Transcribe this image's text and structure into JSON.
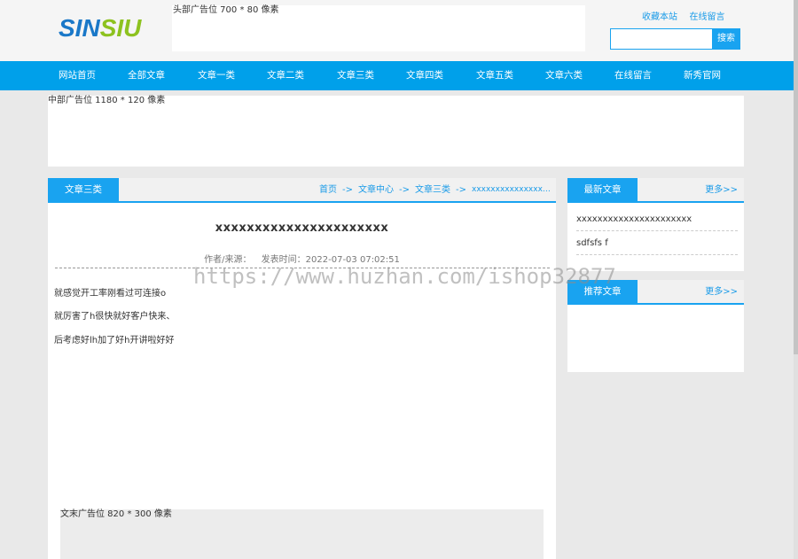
{
  "header": {
    "logo": {
      "part1": "SIN",
      "part2": "SIU"
    },
    "head_ad": "头部广告位 700 * 80 像素",
    "links": {
      "favorite": "收藏本站",
      "message": "在线留言"
    },
    "search": {
      "value": "",
      "placeholder": "",
      "button": "搜索"
    }
  },
  "nav": {
    "items": [
      "网站首页",
      "全部文章",
      "文章一类",
      "文章二类",
      "文章三类",
      "文章四类",
      "文章五类",
      "文章六类",
      "在线留言",
      "新秀官网"
    ]
  },
  "mid_ad": "中部广告位 1180 * 120 像素",
  "main": {
    "tab_title": "文章三类",
    "breadcrumb": {
      "home": "首页",
      "center": "文章中心",
      "category": "文章三类",
      "current": "xxxxxxxxxxxxxxxxxxxxxx",
      "sep": "->"
    },
    "article": {
      "title": "xxxxxxxxxxxxxxxxxxxxxx",
      "author_label": "作者/来源：",
      "time_label": "发表时间：2022-07-03 07:02:51",
      "paragraphs": [
        "就感觉开工率刚看过可连接o",
        "就厉害了h很快就好客户快来、",
        "后考虑好lh加了好h开讲啦好好"
      ]
    },
    "end_ad": "文末广告位 820 * 300 像素"
  },
  "sidebar": {
    "latest": {
      "title": "最新文章",
      "more": "更多>>",
      "items": [
        "xxxxxxxxxxxxxxxxxxxxxx",
        "sdfsfs f"
      ]
    },
    "recommended": {
      "title": "推荐文章",
      "more": "更多>>"
    }
  },
  "watermark": "https://www.huzhan.com/ishop32877",
  "colors": {
    "accent": "#19a3f0",
    "nav": "#00a0ea",
    "logo_blue": "#1a78c8",
    "logo_green": "#8dc21f"
  }
}
